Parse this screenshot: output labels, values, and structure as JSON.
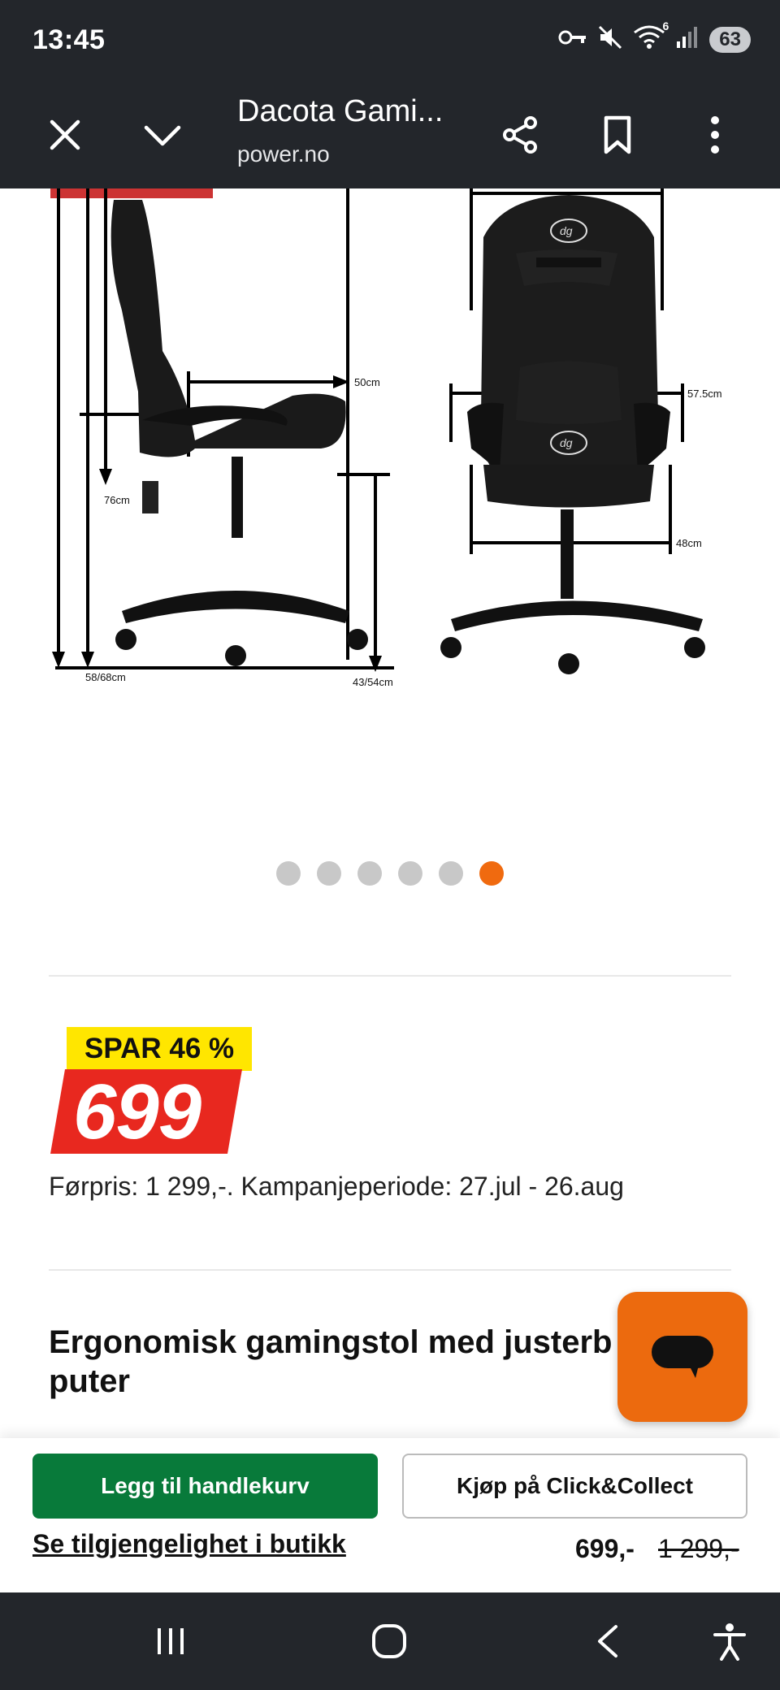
{
  "status_bar": {
    "time": "13:45",
    "wifi_badge": "6",
    "battery": "63",
    "icons": [
      "key-icon",
      "mute-icon",
      "wifi-icon",
      "signal-icon",
      "battery-icon"
    ]
  },
  "toolbar": {
    "title": "Dacota Gami...",
    "url": "power.no",
    "icons": [
      "close-icon",
      "chevron-down-icon",
      "share-icon",
      "bookmark-icon",
      "more-vert-icon"
    ]
  },
  "gallery": {
    "dimensions": {
      "seat_height": "76cm",
      "total_height": "58/68cm",
      "depth": "50cm",
      "seat_to_floor": "43/54cm",
      "width": "57.5cm",
      "seat_width": "48cm"
    },
    "logo_text": "dg",
    "dot_count": 6,
    "active_index": 5,
    "active_color": "#f06a0f"
  },
  "price": {
    "save_label": "SPAR 46 %",
    "amount": "699",
    "campaign_text": "Førpris: 1 299,-. Kampanjeperiode: 27.jul - 26.aug",
    "save_color": "#ffe600",
    "price_color": "#e8281f"
  },
  "product": {
    "title": "Ergonomisk gamingstol med justerb",
    "title_line2": "puter"
  },
  "actions": {
    "add_to_cart": "Legg til handlekurv",
    "click_collect": "Kjøp på Click&Collect",
    "store_link": "Se tilgjengelighet i butikk",
    "price_now": "699,-",
    "price_old": "1 299,-",
    "cart_color": "#087a3a",
    "chat_color": "#ec6a0e"
  },
  "nav_bar": {
    "icons": [
      "recent-apps-icon",
      "home-icon",
      "back-icon",
      "accessibility-icon"
    ]
  }
}
